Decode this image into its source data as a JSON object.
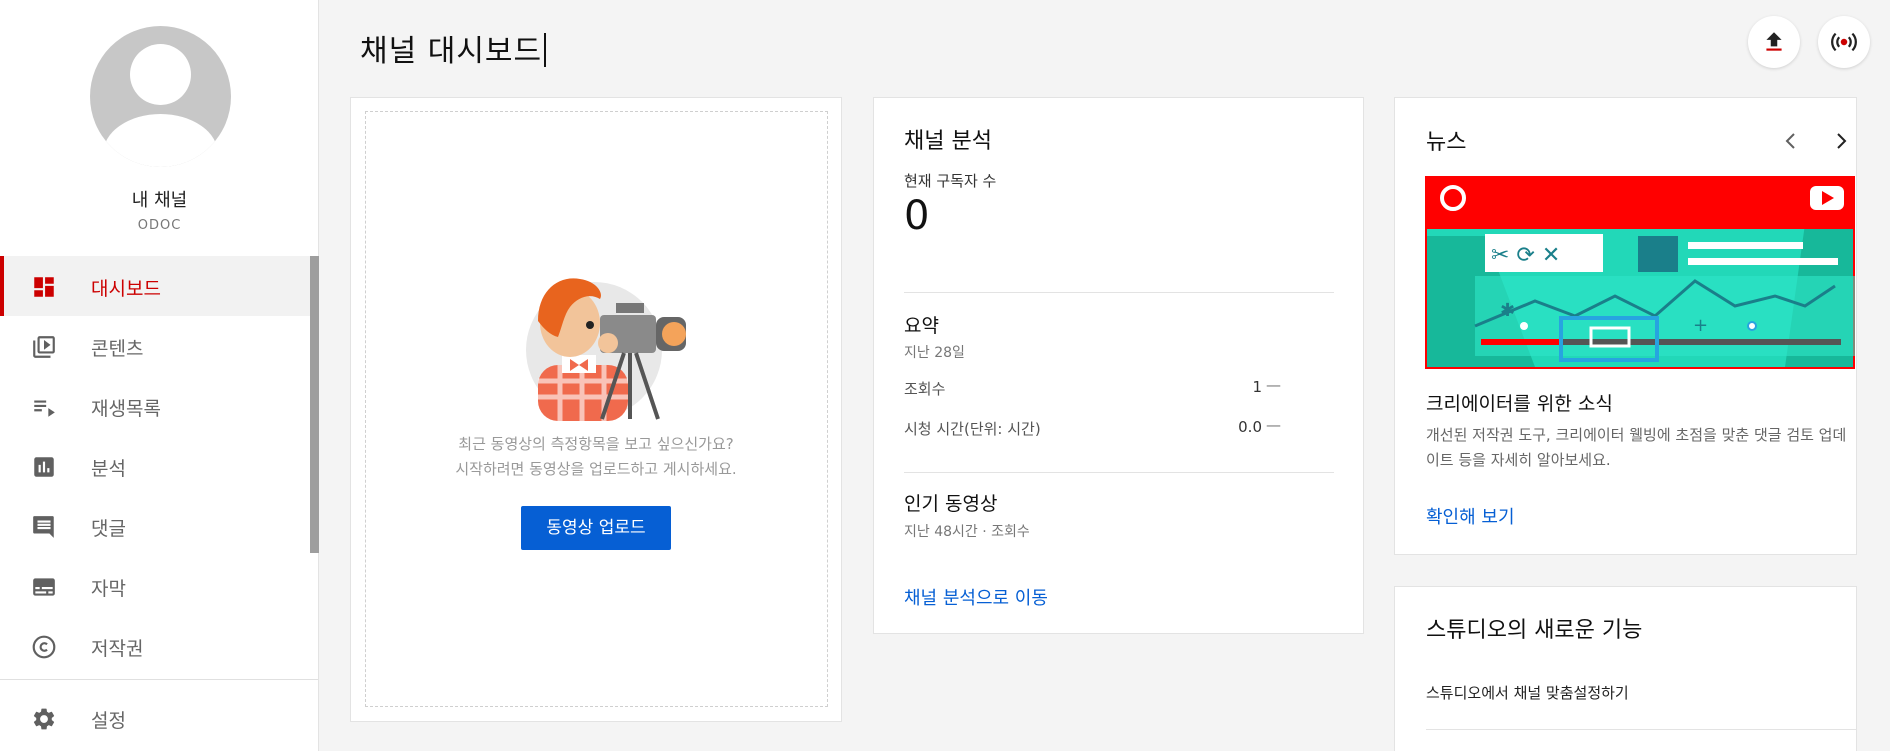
{
  "sidebar": {
    "channel_name": "내 채널",
    "channel_handle": "ODOC",
    "items": [
      {
        "label": "대시보드",
        "icon": "dashboard-icon",
        "active": true
      },
      {
        "label": "콘텐츠",
        "icon": "video-library-icon",
        "active": false
      },
      {
        "label": "재생목록",
        "icon": "playlist-icon",
        "active": false
      },
      {
        "label": "분석",
        "icon": "analytics-icon",
        "active": false
      },
      {
        "label": "댓글",
        "icon": "comment-icon",
        "active": false
      },
      {
        "label": "자막",
        "icon": "subtitles-icon",
        "active": false
      },
      {
        "label": "저작권",
        "icon": "copyright-icon",
        "active": false
      }
    ],
    "settings_label": "설정"
  },
  "header": {
    "title": "채널 대시보드"
  },
  "upload_card": {
    "message_line1": "최근 동영상의 측정항목을 보고 싶으신가요?",
    "message_line2": "시작하려면 동영상을 업로드하고 게시하세요.",
    "button_label": "동영상 업로드"
  },
  "analytics": {
    "title": "채널 분석",
    "subscribers_label": "현재 구독자 수",
    "subscribers_value": "0",
    "summary_title": "요약",
    "summary_period": "지난 28일",
    "views_label": "조회수",
    "views_value": "1",
    "views_change": "—",
    "watch_label": "시청 시간(단위: 시간)",
    "watch_value": "0.0",
    "watch_change": "—",
    "popular_title": "인기 동영상",
    "popular_sub": "지난 48시간 · 조회수",
    "link_label": "채널 분석으로 이동"
  },
  "news": {
    "title": "뉴스",
    "headline": "크리에이터를 위한 소식",
    "description": "개선된 저작권 도구, 크리에이터 웰빙에 초점을 맞춘 댓글 검토 업데이트 등을 자세히 알아보세요.",
    "link_label": "확인해 보기"
  },
  "studio": {
    "title": "스튜디오의 새로운 기능",
    "item": "스튜디오에서 채널 맞춤설정하기"
  },
  "colors": {
    "accent_red": "#cc0000",
    "link_blue": "#065fd4",
    "banner_red": "#ff0000",
    "banner_teal": "#22d8b8"
  }
}
